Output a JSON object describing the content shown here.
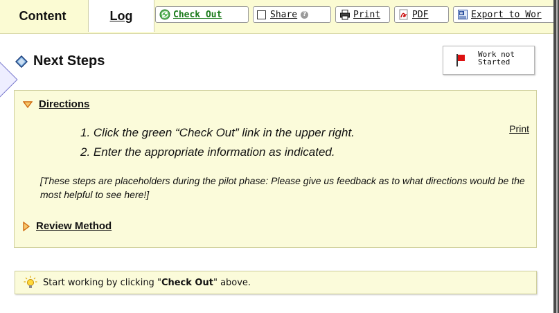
{
  "tabs": [
    {
      "label": "Content",
      "active": true
    },
    {
      "label": "Log",
      "active": false
    }
  ],
  "toolbar": {
    "checkout_label": "Check Out",
    "share_label": "Share",
    "print_label": "Print",
    "pdf_label": "PDF",
    "export_label": "Export to Wor"
  },
  "page": {
    "title": "Next Steps",
    "title_icon": "diamond-icon",
    "status_label": "Work not Started",
    "status_icon": "red-flag-icon"
  },
  "directions": {
    "label": "Directions",
    "expanded": true,
    "print_link": "Print",
    "steps": [
      "1. Click the green “Check Out” link in the upper right.",
      "2. Enter the appropriate information as indicated."
    ],
    "note": "[These steps are placeholders during the pilot phase: Please give us feedback as to what directions would be the most helpful to see here!]"
  },
  "review": {
    "label": "Review Method",
    "expanded": false
  },
  "hint": {
    "prefix": "Start working by clicking \"",
    "bold": "Check Out",
    "suffix": "\" above."
  },
  "colors": {
    "tabbar_bg": "#fbfbd3",
    "panel_bg": "#fbfbda",
    "checkout_green": "#1a7a1a",
    "arrow_orange": "#e07a10",
    "flag_red": "#dd1111"
  }
}
